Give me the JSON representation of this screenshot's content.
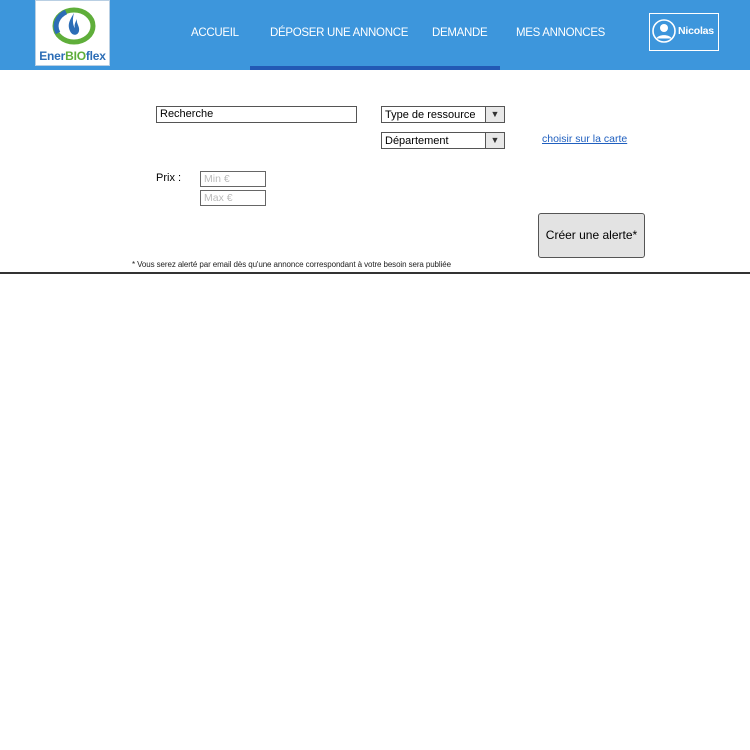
{
  "brand": {
    "logo_text_part1": "Ener",
    "logo_text_part2": "BIO",
    "logo_text_part3": "flex",
    "header_color": "#3d96dc",
    "active_bar_color": "#2259b5"
  },
  "nav": {
    "items": [
      {
        "label": "ACCUEIL"
      },
      {
        "label": "DÉPOSER UNE ANNONCE"
      },
      {
        "label": "DEMANDE"
      },
      {
        "label": "MES ANNONCES"
      }
    ]
  },
  "user": {
    "name": "Nicolas",
    "icon": "user-avatar-icon"
  },
  "search": {
    "value": "Recherche"
  },
  "filters": {
    "resource_type": "Type de ressource",
    "department": "Département",
    "map_link": "choisir sur la carte",
    "dropdown_icon": "triangle-down-icon"
  },
  "price": {
    "label": "Prix :",
    "min_placeholder": "Min   €",
    "max_placeholder": "Max   €"
  },
  "alert": {
    "button_label": "Créer une alerte*",
    "footnote": "* Vous serez alerté par email dès qu'une annonce correspondant à votre besoin sera publiée"
  }
}
